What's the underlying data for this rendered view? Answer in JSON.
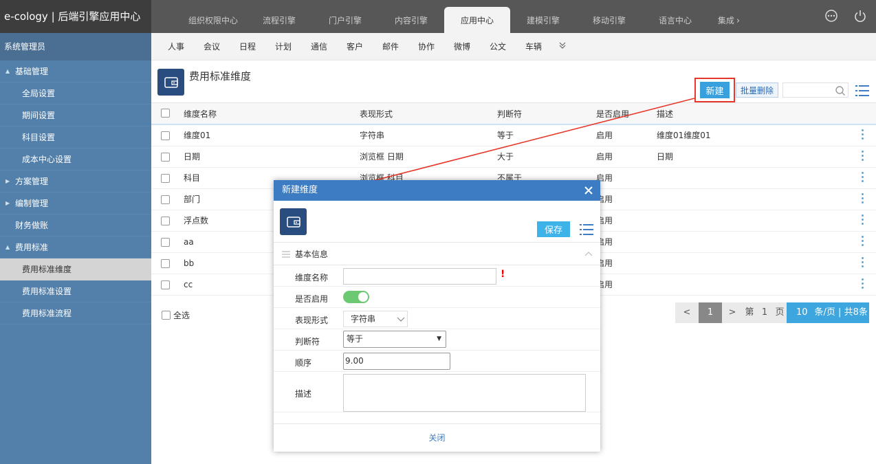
{
  "app": {
    "brand": "e-cology | 后端引擎应用中心"
  },
  "top_tabs": [
    {
      "label": "组织权限中心"
    },
    {
      "label": "流程引擎"
    },
    {
      "label": "门户引擎"
    },
    {
      "label": "内容引擎"
    },
    {
      "label": "应用中心",
      "active": true
    },
    {
      "label": "建模引擎"
    },
    {
      "label": "移动引擎"
    },
    {
      "label": "语言中心"
    },
    {
      "label": "集成"
    }
  ],
  "sidebar": {
    "title": "系统管理员",
    "items": [
      {
        "label": "基础管理",
        "type": "group",
        "arrow": "▲"
      },
      {
        "label": "全局设置",
        "type": "leaf"
      },
      {
        "label": "期间设置",
        "type": "leaf"
      },
      {
        "label": "科目设置",
        "type": "leaf"
      },
      {
        "label": "成本中心设置",
        "type": "leaf"
      },
      {
        "label": "方案管理",
        "type": "group",
        "arrow": "▶"
      },
      {
        "label": "编制管理",
        "type": "group",
        "arrow": "▶"
      },
      {
        "label": "财务做账",
        "type": "group",
        "arrow": ""
      },
      {
        "label": "费用标准",
        "type": "group",
        "arrow": "▲"
      },
      {
        "label": "费用标准维度",
        "type": "leaf",
        "active": true
      },
      {
        "label": "费用标准设置",
        "type": "leaf"
      },
      {
        "label": "费用标准流程",
        "type": "leaf"
      }
    ]
  },
  "sub_tabs": [
    "人事",
    "会议",
    "日程",
    "计划",
    "通信",
    "客户",
    "邮件",
    "协作",
    "微博",
    "公文",
    "车辆"
  ],
  "page": {
    "title": "费用标准维度",
    "new_label": "新建",
    "batch_delete_label": "批量删除",
    "search_placeholder": ""
  },
  "table": {
    "headers": [
      "维度名称",
      "表现形式",
      "判断符",
      "是否启用",
      "描述"
    ],
    "rows": [
      {
        "name": "维度01",
        "form": "字符串",
        "op": "等于",
        "enabled": "启用",
        "desc": "维度01维度01"
      },
      {
        "name": "日期",
        "form": "浏览框 日期",
        "op": "大于",
        "enabled": "启用",
        "desc": "日期"
      },
      {
        "name": "科目",
        "form": "浏览框 科目",
        "op": "不属于",
        "enabled": "启用",
        "desc": ""
      },
      {
        "name": "部门",
        "form": "",
        "op": "",
        "enabled": "启用",
        "desc": ""
      },
      {
        "name": "浮点数",
        "form": "",
        "op": "",
        "enabled": "启用",
        "desc": ""
      },
      {
        "name": "aa",
        "form": "",
        "op": "",
        "enabled": "启用",
        "desc": ""
      },
      {
        "name": "bb",
        "form": "",
        "op": "",
        "enabled": "启用",
        "desc": ""
      },
      {
        "name": "cc",
        "form": "",
        "op": "",
        "enabled": "启用",
        "desc": ""
      }
    ],
    "select_all_label": "全选"
  },
  "pager": {
    "prev": "<",
    "current": "1",
    "next": ">",
    "page_prefix": "第",
    "page_value": "1",
    "page_suffix": "页",
    "page_size": "10",
    "size_text": "条/页 | 共8条"
  },
  "modal": {
    "title": "新建维度",
    "save_label": "保存",
    "section_title": "基本信息",
    "fields": {
      "name_label": "维度名称",
      "name_value": "",
      "required_mark": "!",
      "enabled_label": "是否启用",
      "enabled": true,
      "form_label": "表现形式",
      "form_value": "字符串",
      "judge_label": "判断符",
      "judge_value": "等于",
      "order_label": "顺序",
      "order_value": "9.00",
      "desc_label": "描述",
      "desc_value": ""
    },
    "close_label": "关闭"
  },
  "colors": {
    "brand_bg": "#3d3d3d",
    "sidebar_bg": "#5280ab",
    "accent": "#37a0dd",
    "modal_header": "#3d7cc2",
    "annotation": "#e7372b",
    "toggle_on": "#6cc872"
  }
}
